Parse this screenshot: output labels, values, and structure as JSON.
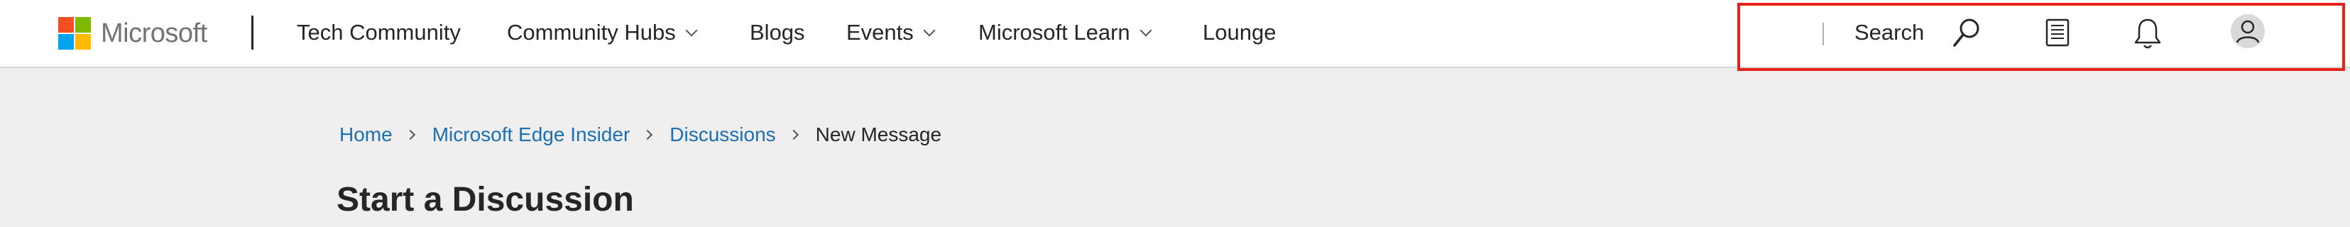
{
  "header": {
    "brand": "Microsoft",
    "site_name": "Tech Community",
    "nav": [
      {
        "label": "Community Hubs",
        "has_dropdown": true
      },
      {
        "label": "Blogs",
        "has_dropdown": false
      },
      {
        "label": "Events",
        "has_dropdown": true
      },
      {
        "label": "Microsoft Learn",
        "has_dropdown": true
      },
      {
        "label": "Lounge",
        "has_dropdown": false
      }
    ],
    "search_label": "Search",
    "icons": [
      "search-icon",
      "notes-icon",
      "bell-icon",
      "user-avatar-icon"
    ]
  },
  "breadcrumb": {
    "items": [
      "Home",
      "Microsoft Edge Insider",
      "Discussions"
    ],
    "current": "New Message"
  },
  "page": {
    "title": "Start a Discussion"
  },
  "colors": {
    "logo_red": "#f25022",
    "logo_green": "#7fba00",
    "logo_blue": "#00a4ef",
    "logo_yellow": "#ffb900",
    "link": "#1a6fb5",
    "background": "#f0eeef",
    "highlight": "#e8221a"
  }
}
